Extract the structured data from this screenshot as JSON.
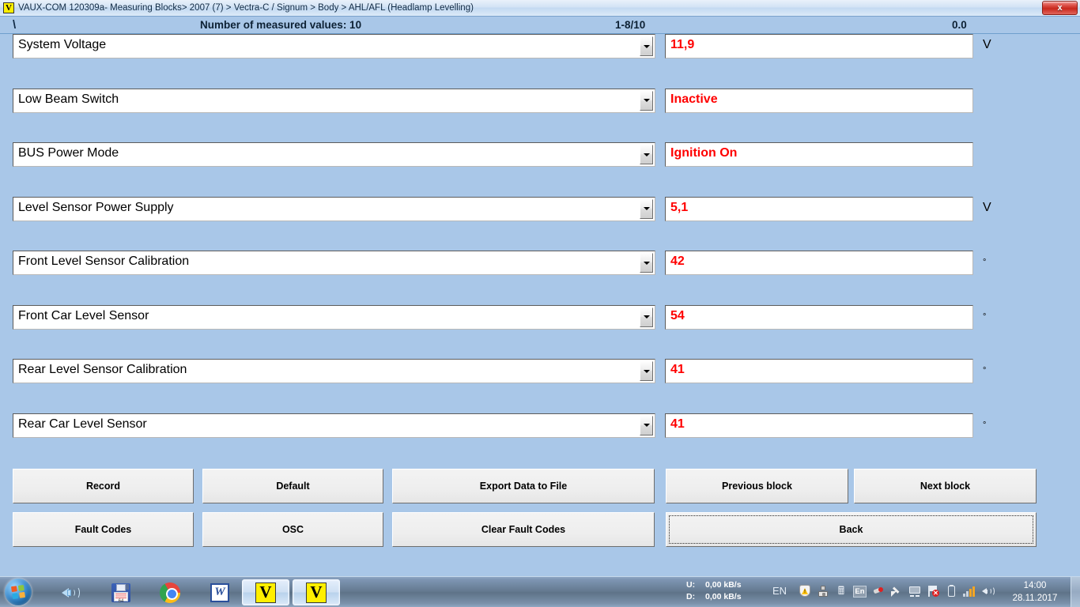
{
  "window": {
    "icon": "vaux-app-icon",
    "title": "VAUX-COM 120309a- Measuring Blocks> 2007 (7) > Vectra-C / Signum > Body > AHL/AFL (Headlamp Levelling)",
    "close_label": "x"
  },
  "info": {
    "backslash": "\\",
    "measured_values": "Number of measured values: 10",
    "range": "1-8/10",
    "value": "0.0"
  },
  "rows": [
    {
      "label": "System Voltage",
      "value": "11,9",
      "unit": "V",
      "unit_type": "text"
    },
    {
      "label": "Low Beam Switch",
      "value": "Inactive",
      "unit": "",
      "unit_type": "none"
    },
    {
      "label": "BUS Power Mode",
      "value": "Ignition On",
      "unit": "",
      "unit_type": "none"
    },
    {
      "label": "Level Sensor Power Supply",
      "value": "5,1",
      "unit": "V",
      "unit_type": "text"
    },
    {
      "label": "Front Level Sensor Calibration",
      "value": "42",
      "unit": "°",
      "unit_type": "degree"
    },
    {
      "label": "Front Car Level Sensor",
      "value": "54",
      "unit": "°",
      "unit_type": "degree"
    },
    {
      "label": "Rear Level Sensor Calibration",
      "value": "41",
      "unit": "°",
      "unit_type": "degree"
    },
    {
      "label": "Rear Car Level Sensor",
      "value": "41",
      "unit": "°",
      "unit_type": "degree"
    }
  ],
  "buttons": {
    "record": "Record",
    "default": "Default",
    "export": "Export Data to File",
    "previous_block": "Previous block",
    "next_block": "Next block",
    "fault_codes": "Fault Codes",
    "osc": "OSC",
    "clear_fault_codes": "Clear Fault Codes",
    "back": "Back"
  },
  "taskbar": {
    "start": "start-orb",
    "items": [
      {
        "name": "volume-mixer",
        "icon": "speaker-icon"
      },
      {
        "name": "floppy-save",
        "icon": "floppy-disk-icon",
        "caption": "64"
      },
      {
        "name": "chrome",
        "icon": "chrome-icon"
      },
      {
        "name": "word",
        "icon": "word-icon",
        "glyph": "W"
      },
      {
        "name": "vauxcom-1",
        "icon": "vaux-icon",
        "glyph": "V"
      },
      {
        "name": "vauxcom-2",
        "icon": "vaux-icon",
        "glyph": "V"
      }
    ],
    "tray": {
      "upload_label": "U:",
      "download_label": "D:",
      "upload_speed": "0,00 kB/s",
      "download_speed": "0,00 kB/s",
      "language": "EN",
      "keyboard_layout": "En",
      "icons": [
        "action-center-warning-icon",
        "network-tower-icon",
        "bluetooth-icon",
        "keyboard-language-icon",
        "red-device-icon",
        "safely-remove-icon",
        "monitor-icon",
        "network-error-flag-icon",
        "battery-icon",
        "signal-bars-icon",
        "volume-icon"
      ],
      "time": "14:00",
      "date": "28.11.2017"
    }
  },
  "colors": {
    "background": "#a9c7e8",
    "value_text": "#ff0000",
    "field_bg": "#ffffff"
  }
}
